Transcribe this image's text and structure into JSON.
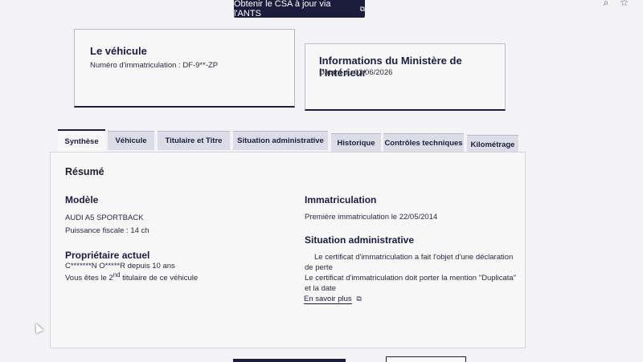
{
  "banner": {
    "text": "Obtenir le CSA à jour via l'ANTS",
    "icon": "external-link-icon"
  },
  "vehicle_card": {
    "title": "Le véhicule",
    "subtitle": "Numéro d'immatriculation : DF-9**-ZP"
  },
  "ministry_card": {
    "title": "Informations du Ministère de l'Intérieur",
    "subtitle": "Datant du 03/06/2026"
  },
  "tabs": [
    {
      "label": "Synthèse",
      "active": true
    },
    {
      "label": "Véhicule",
      "active": false
    },
    {
      "label": "Titulaire et Titre",
      "active": false
    },
    {
      "label": "Situation administrative",
      "active": false
    },
    {
      "label": "Historique",
      "active": false
    },
    {
      "label": "Contrôles techniques",
      "active": false
    },
    {
      "label": "Kilométrage",
      "active": false
    }
  ],
  "summary": {
    "title": "Résumé",
    "model": {
      "heading": "Modèle",
      "name": "AUDI A5 SPORTBACK",
      "power": "Puissance fiscale : 14 ch"
    },
    "owner": {
      "heading": "Propriétaire actuel",
      "name": "C*******N O*****R depuis 10 ans",
      "rank_prefix": "Vous êtes le 2",
      "rank_sup": "nd",
      "rank_suffix": " titulaire de ce véhicule"
    },
    "registration": {
      "heading": "Immatriculation",
      "first": "Première immatriculation le 22/05/2014"
    },
    "admin": {
      "heading": "Situation administrative",
      "line1": "Le certificat d'immatriculation a fait l'objet d'une déclaration de perte",
      "line2": "Le certificat d'immatriculation doit porter la mention \"Duplicata\" et la date",
      "link": "En savoir plus"
    }
  }
}
